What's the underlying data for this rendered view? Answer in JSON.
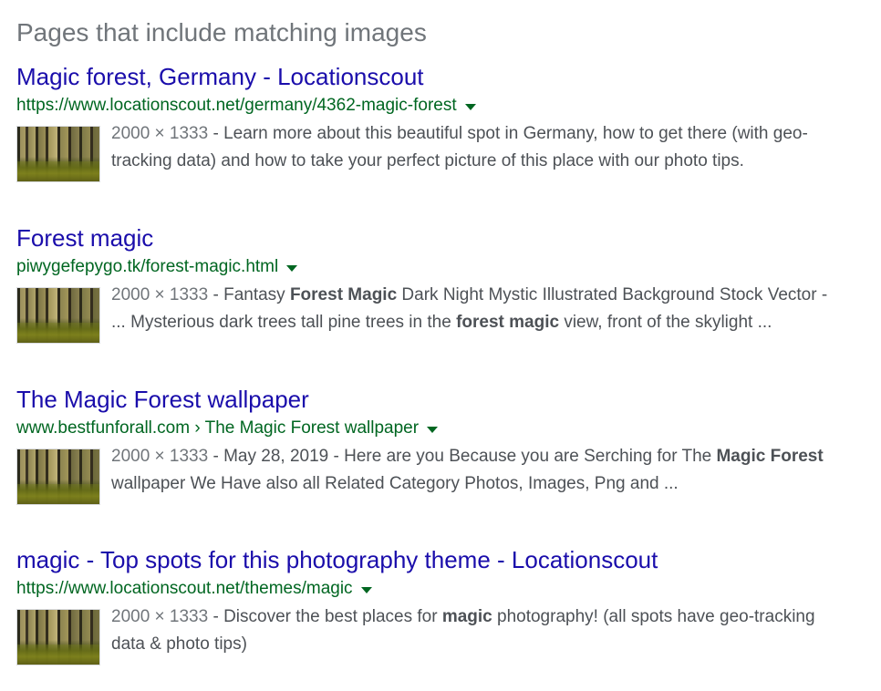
{
  "heading": "Pages that include matching images",
  "results": [
    {
      "title": "Magic forest, Germany - Locationscout",
      "url": "https://www.locationscout.net/germany/4362-magic-forest",
      "dimensions": "2000 × 1333",
      "snippet": [
        {
          "text": " - Learn more about this beautiful spot in Germany, how to get there (with geo-tracking data) and how to take your perfect picture of this place with our photo tips.",
          "bold": false
        }
      ]
    },
    {
      "title": "Forest magic",
      "url": "piwygefepygo.tk/forest-magic.html",
      "dimensions": "2000 × 1333",
      "snippet": [
        {
          "text": " - Fantasy ",
          "bold": false
        },
        {
          "text": "Forest Magic",
          "bold": true
        },
        {
          "text": " Dark Night Mystic Illustrated Background Stock Vector - ... Mysterious dark trees tall pine trees in the ",
          "bold": false
        },
        {
          "text": "forest magic",
          "bold": true
        },
        {
          "text": " view, front of the skylight ...",
          "bold": false
        }
      ]
    },
    {
      "title": "The Magic Forest wallpaper",
      "url": "www.bestfunforall.com › The Magic Forest wallpaper",
      "dimensions": "2000 × 1333",
      "snippet": [
        {
          "text": " - May 28, 2019 - Here are you Because you are Serching for The ",
          "bold": false
        },
        {
          "text": "Magic Forest",
          "bold": true
        },
        {
          "text": " wallpaper We Have also all Related Category Photos, Images, Png and ...",
          "bold": false
        }
      ]
    },
    {
      "title": "magic - Top spots for this photography theme - Locationscout",
      "url": "https://www.locationscout.net/themes/magic",
      "dimensions": "2000 × 1333",
      "snippet": [
        {
          "text": " - Discover the best places for ",
          "bold": false
        },
        {
          "text": "magic",
          "bold": true
        },
        {
          "text": " photography! (all spots have geo-tracking data & photo tips)",
          "bold": false
        }
      ]
    }
  ],
  "icons": {
    "url_menu": "dropdown-arrow-icon",
    "thumbnail": "forest-thumbnail-image"
  },
  "colors": {
    "title_link": "#1a0dab",
    "url": "#006621",
    "heading": "#70757a",
    "snippet": "#4d5156"
  }
}
